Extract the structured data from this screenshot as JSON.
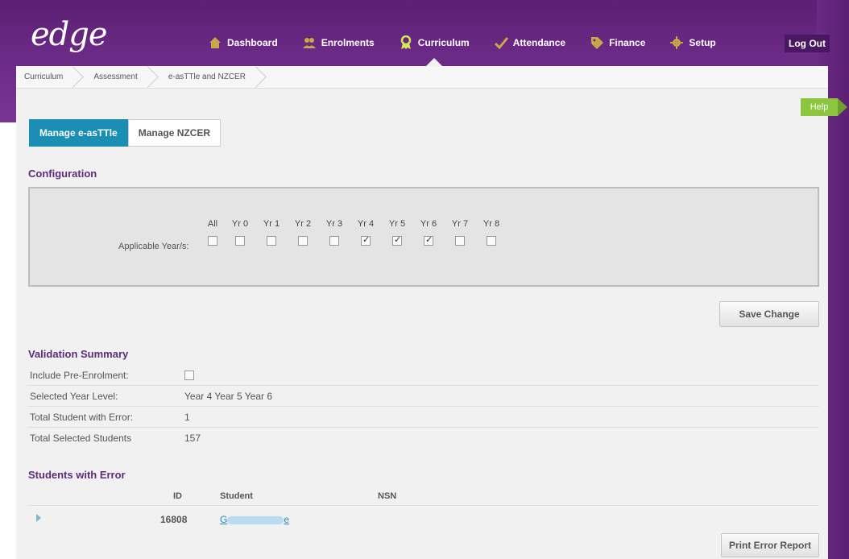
{
  "app": {
    "logo": "edge"
  },
  "nav": {
    "items": [
      {
        "label": "Dashboard",
        "icon": "home-icon"
      },
      {
        "label": "Enrolments",
        "icon": "people-icon"
      },
      {
        "label": "Curriculum",
        "icon": "award-icon",
        "active": true
      },
      {
        "label": "Attendance",
        "icon": "checkmark-icon"
      },
      {
        "label": "Finance",
        "icon": "tag-icon"
      },
      {
        "label": "Setup",
        "icon": "gear-icon"
      }
    ],
    "logout": "Log Out"
  },
  "breadcrumb": [
    "Curriculum",
    "Assessment",
    "e-asTTle and NZCER"
  ],
  "help": "Help",
  "tabs": [
    {
      "label": "Manage e-asTTle",
      "active": true
    },
    {
      "label": "Manage NZCER",
      "active": false
    }
  ],
  "configuration": {
    "title": "Configuration",
    "applicable_label": "Applicable Year/s:",
    "years": [
      {
        "label": "All",
        "checked": false
      },
      {
        "label": "Yr 0",
        "checked": false
      },
      {
        "label": "Yr 1",
        "checked": false
      },
      {
        "label": "Yr 2",
        "checked": false
      },
      {
        "label": "Yr 3",
        "checked": false
      },
      {
        "label": "Yr 4",
        "checked": true
      },
      {
        "label": "Yr 5",
        "checked": true
      },
      {
        "label": "Yr 6",
        "checked": true
      },
      {
        "label": "Yr 7",
        "checked": false
      },
      {
        "label": "Yr 8",
        "checked": false
      }
    ],
    "save_label": "Save Change"
  },
  "validation": {
    "title": "Validation Summary",
    "include_pre_label": "Include Pre-Enrolment:",
    "include_pre_checked": false,
    "selected_year_label": "Selected Year Level:",
    "selected_year_value": "Year 4 Year 5 Year 6",
    "total_error_label": "Total Student with Error:",
    "total_error_value": "1",
    "total_selected_label": "Total Selected Students",
    "total_selected_value": "157"
  },
  "errors": {
    "title": "Students with Error",
    "columns": [
      "ID",
      "Student",
      "NSN"
    ],
    "rows": [
      {
        "id": "16808",
        "student_first": "G",
        "student_last": "e",
        "nsn": ""
      }
    ],
    "print_label": "Print Error Report"
  }
}
